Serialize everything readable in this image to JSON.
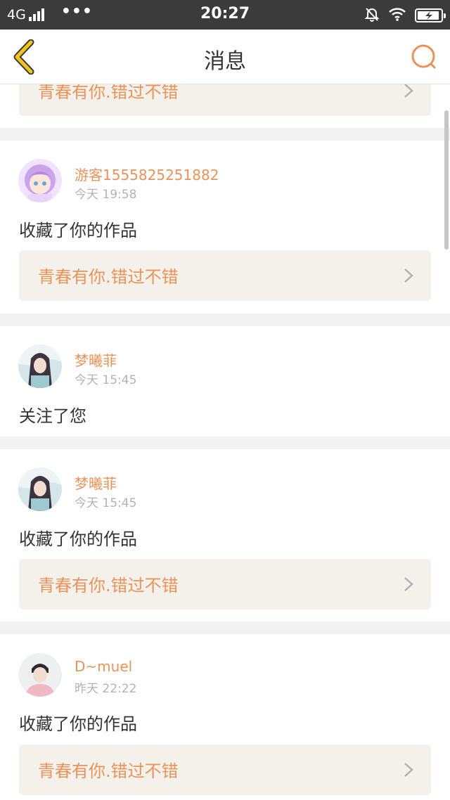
{
  "status_bar": {
    "network": "4G",
    "more": "•••",
    "time": "20:27"
  },
  "header": {
    "title": "消息"
  },
  "feed": [
    {
      "work_title": "青春有你.错过不错"
    },
    {
      "username": "游客1555825251882",
      "time": "今天 19:58",
      "action": "收藏了你的作品",
      "work_title": "青春有你.错过不错"
    },
    {
      "username": "梦曦菲",
      "time": "今天 15:45",
      "action": "关注了您"
    },
    {
      "username": "梦曦菲",
      "time": "今天 15:45",
      "action": "收藏了你的作品",
      "work_title": "青春有你.错过不错"
    },
    {
      "username": "D~muel",
      "time": "昨天 22:22",
      "action": "收藏了你的作品",
      "work_title": "青春有你.错过不错"
    }
  ],
  "icons": {
    "back": "chevron-left-icon",
    "search": "search-icon",
    "chevron": "chevron-right-icon",
    "mute": "bell-off-icon",
    "wifi": "wifi-icon",
    "battery": "battery-charging-icon"
  },
  "colors": {
    "accent": "#e8935a",
    "back_icon": "#f0c419",
    "link_bg": "#f4f1ea",
    "status_bar": "#3b3b3b"
  }
}
